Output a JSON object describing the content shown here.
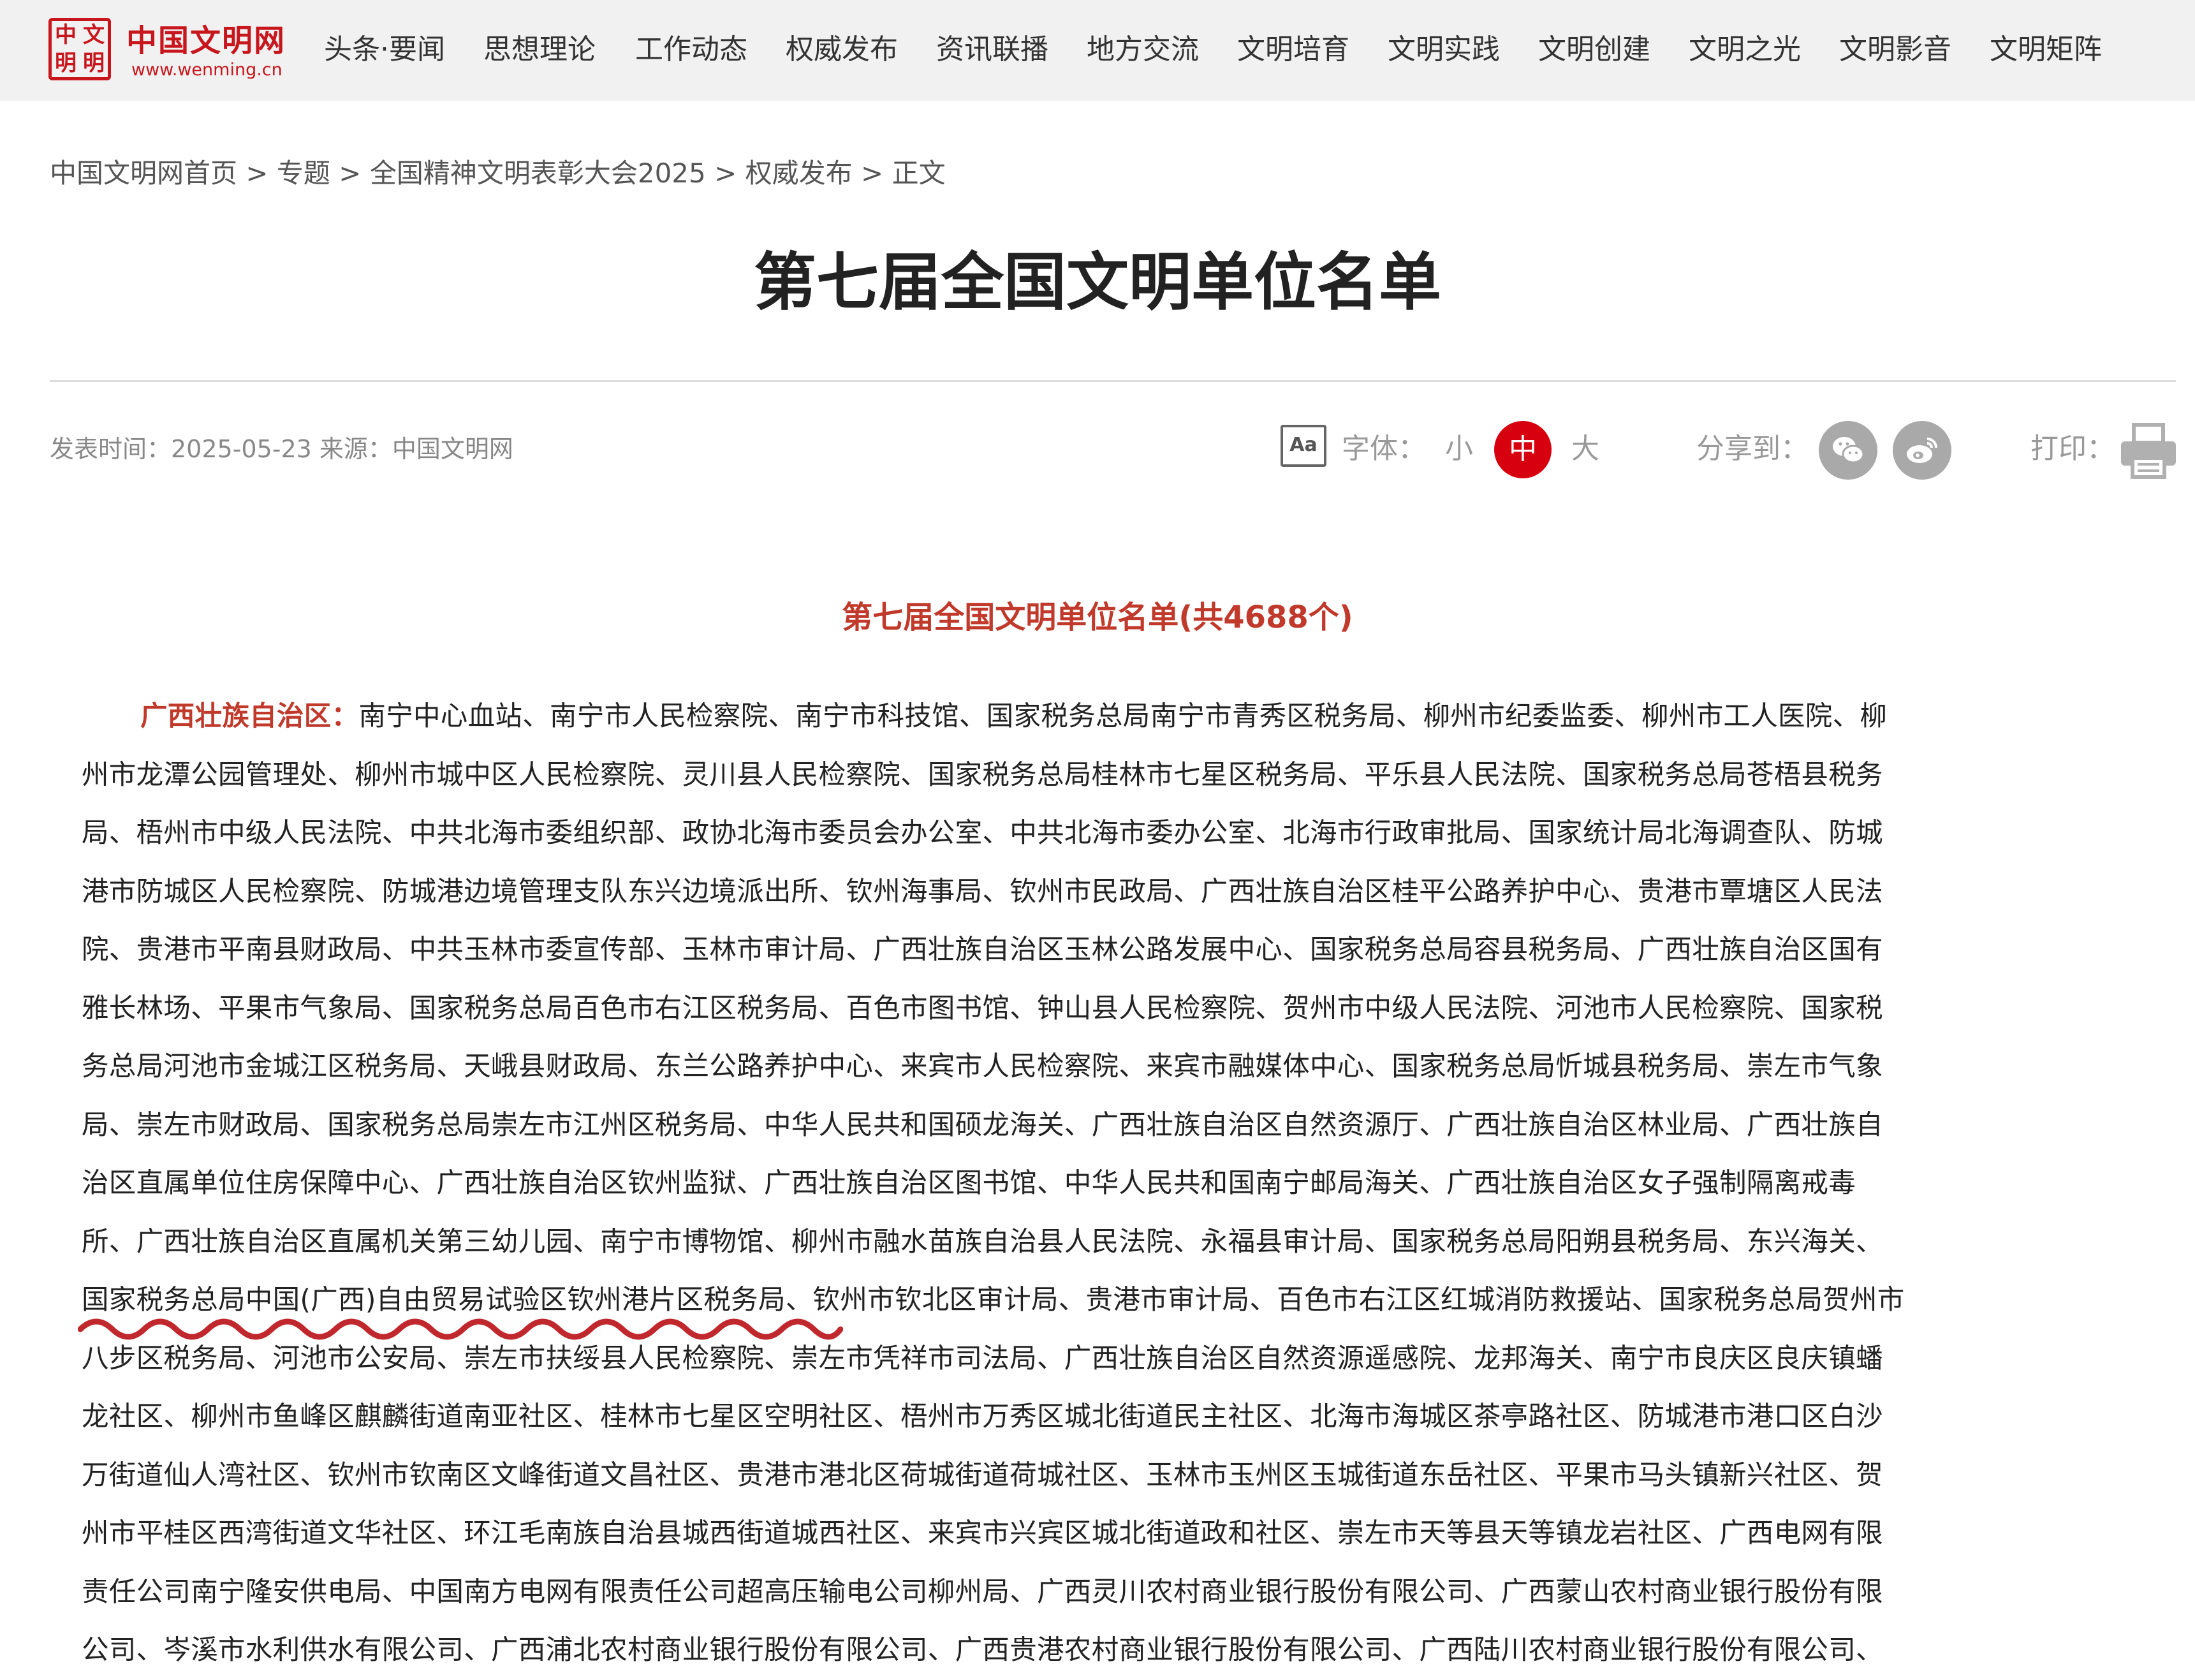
{
  "site": {
    "logo_seal": [
      "中",
      "文",
      "明",
      "明"
    ],
    "logo_title": "中国文明网",
    "logo_url": "www.wenming.cn"
  },
  "nav": [
    "头条·要闻",
    "思想理论",
    "工作动态",
    "权威发布",
    "资讯联播",
    "地方交流",
    "文明培育",
    "文明实践",
    "文明创建",
    "文明之光",
    "文明影音",
    "文明矩阵"
  ],
  "breadcrumb": [
    "中国文明网首页",
    "专题",
    "全国精神文明表彰大会2025",
    "权威发布",
    "正文"
  ],
  "breadcrumb_sep": " > ",
  "title": "第七届全国文明单位名单",
  "meta": {
    "text": "发表时间：2025-05-23 来源：中国文明网"
  },
  "tools": {
    "font_icon": "Aa",
    "font_label": "字体：",
    "size_small": "小",
    "size_medium": "中",
    "size_large": "大",
    "share_label": "分享到：",
    "print_label": "打印："
  },
  "colors": {
    "accent_red": "#c8161d",
    "heading_red": "#c0392b",
    "active_size": "#d7000f",
    "squiggle": "#c0282d"
  },
  "icons": [
    "wechat-icon",
    "weibo-icon",
    "print-icon",
    "font-size-icon"
  ],
  "article": {
    "list_heading": "第七届全国文明单位名单(共4688个)",
    "region": "广西壮族自治区：",
    "lines": [
      "南宁中心血站、南宁市人民检察院、南宁市科技馆、国家税务总局南宁市青秀区税务局、柳州市纪委监委、柳州市工人医院、柳",
      "州市龙潭公园管理处、柳州市城中区人民检察院、灵川县人民检察院、国家税务总局桂林市七星区税务局、平乐县人民法院、国家税务总局苍梧县税务",
      "局、梧州市中级人民法院、中共北海市委组织部、政协北海市委员会办公室、中共北海市委办公室、北海市行政审批局、国家统计局北海调查队、防城",
      "港市防城区人民检察院、防城港边境管理支队东兴边境派出所、钦州海事局、钦州市民政局、广西壮族自治区桂平公路养护中心、贵港市覃塘区人民法",
      "院、贵港市平南县财政局、中共玉林市委宣传部、玉林市审计局、广西壮族自治区玉林公路发展中心、国家税务总局容县税务局、广西壮族自治区国有",
      "雅长林场、平果市气象局、国家税务总局百色市右江区税务局、百色市图书馆、钟山县人民检察院、贺州市中级人民法院、河池市人民检察院、国家税",
      "务总局河池市金城江区税务局、天峨县财政局、东兰公路养护中心、来宾市人民检察院、来宾市融媒体中心、国家税务总局忻城县税务局、崇左市气象",
      "局、崇左市财政局、国家税务总局崇左市江州区税务局、中华人民共和国硕龙海关、广西壮族自治区自然资源厅、广西壮族自治区林业局、广西壮族自",
      "治区直属单位住房保障中心、广西壮族自治区钦州监狱、广西壮族自治区图书馆、中华人民共和国南宁邮局海关、广西壮族自治区女子强制隔离戒毒",
      "所、广西壮族自治区直属机关第三幼儿园、南宁市博物馆、柳州市融水苗族自治县人民法院、永福县审计局、国家税务总局阳朔县税务局、东兴海关、",
      "国家税务总局中国(广西)自由贸易试验区钦州港片区税务局、钦州市钦北区审计局、贵港市审计局、百色市右江区红城消防救援站、国家税务总局贺州市",
      "八步区税务局、河池市公安局、崇左市扶绥县人民检察院、崇左市凭祥市司法局、广西壮族自治区自然资源遥感院、龙邦海关、南宁市良庆区良庆镇蟠",
      "龙社区、柳州市鱼峰区麒麟街道南亚社区、桂林市七星区空明社区、梧州市万秀区城北街道民主社区、北海市海城区茶亭路社区、防城港市港口区白沙",
      "万街道仙人湾社区、钦州市钦南区文峰街道文昌社区、贵港市港北区荷城街道荷城社区、玉林市玉州区玉城街道东岳社区、平果市马头镇新兴社区、贺",
      "州市平桂区西湾街道文华社区、环江毛南族自治县城西街道城西社区、来宾市兴宾区城北街道政和社区、崇左市天等县天等镇龙岩社区、广西电网有限",
      "责任公司南宁隆安供电局、中国南方电网有限责任公司超高压输电公司柳州局、广西灵川农村商业银行股份有限公司、广西蒙山农村商业银行股份有限",
      "公司、岑溪市水利供水有限公司、广西浦北农村商业银行股份有限公司、广西贵港农村商业银行股份有限公司、广西陆川农村商业银行股份有限公司、"
    ]
  }
}
